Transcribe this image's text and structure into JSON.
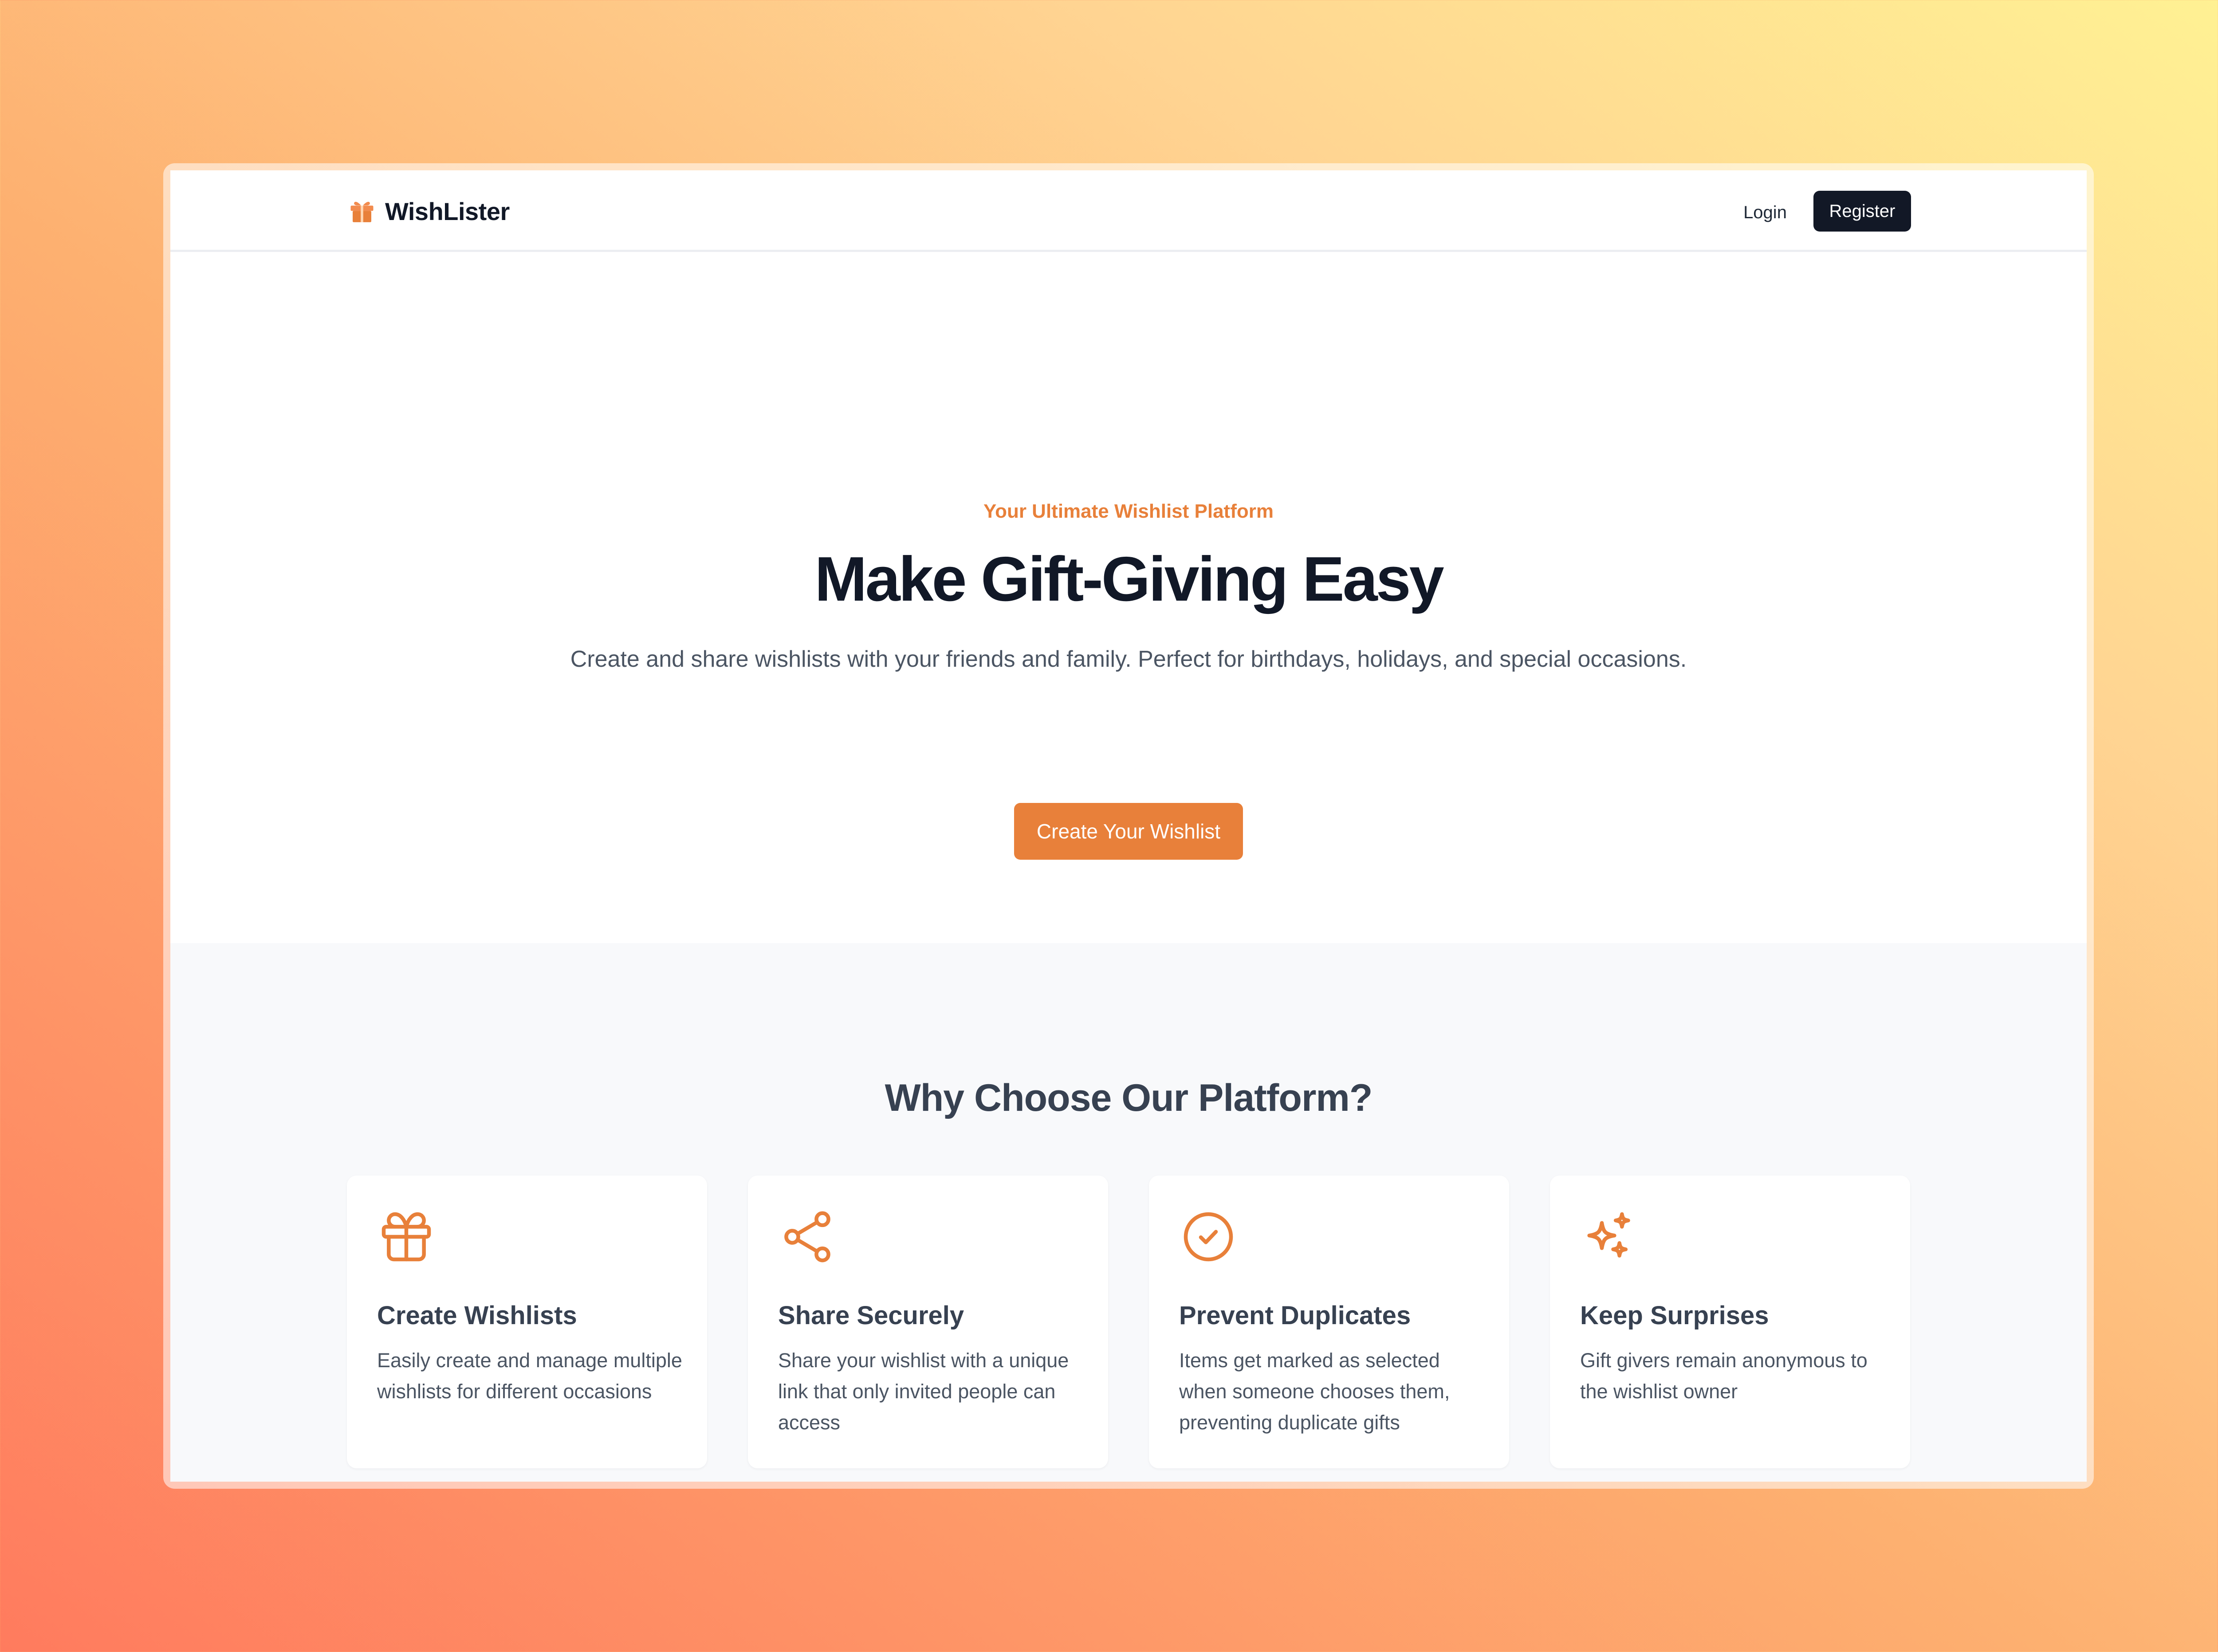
{
  "brand": {
    "name": "WishLister",
    "icon": "gift-icon"
  },
  "nav": {
    "login_label": "Login",
    "register_label": "Register"
  },
  "hero": {
    "tagline": "Your Ultimate Wishlist Platform",
    "headline": "Make Gift-Giving Easy",
    "subtitle": "Create and share wishlists with your friends and family. Perfect for birthdays, holidays, and special occasions.",
    "cta_label": "Create Your Wishlist"
  },
  "features": {
    "title": "Why Choose Our Platform?",
    "items": [
      {
        "icon": "gift-icon",
        "title": "Create Wishlists",
        "desc": "Easily create and manage multiple wishlists for different occasions"
      },
      {
        "icon": "share-icon",
        "title": "Share Securely",
        "desc": "Share your wishlist with a unique link that only invited people can access"
      },
      {
        "icon": "check-circle-icon",
        "title": "Prevent Duplicates",
        "desc": "Items get marked as selected when someone chooses them, preventing duplicate gifts"
      },
      {
        "icon": "sparkles-icon",
        "title": "Keep Surprises",
        "desc": "Gift givers remain anonymous to the wishlist owner"
      }
    ]
  },
  "colors": {
    "accent": "#e8803a",
    "dark": "#121826",
    "text": "#374151",
    "muted": "#4b5563",
    "section_bg": "#f8f9fb"
  }
}
